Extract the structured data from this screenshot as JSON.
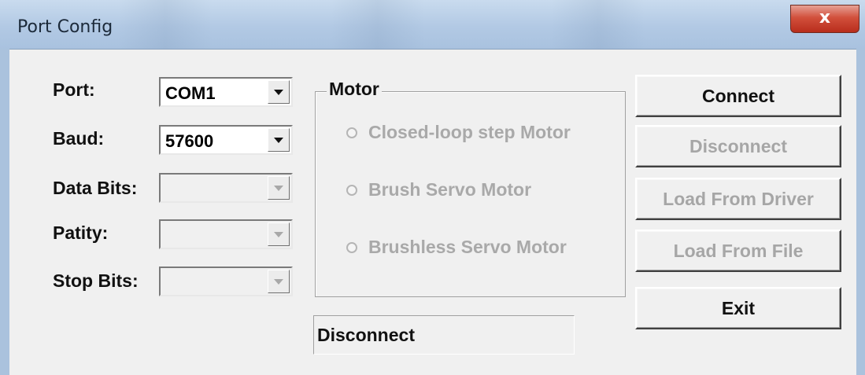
{
  "window": {
    "title": "Port Config",
    "close_label": "x"
  },
  "fields": [
    {
      "label": "Port:",
      "value": "COM1",
      "disabled": false
    },
    {
      "label": "Baud:",
      "value": "57600",
      "disabled": false
    },
    {
      "label": "Data Bits:",
      "value": "",
      "disabled": true
    },
    {
      "label": "Patity:",
      "value": "",
      "disabled": true
    },
    {
      "label": "Stop Bits:",
      "value": "",
      "disabled": true
    }
  ],
  "motor": {
    "title": "Motor",
    "options": [
      {
        "label": "Closed-loop step Motor",
        "selected": false,
        "disabled": true
      },
      {
        "label": "Brush Servo Motor",
        "selected": false,
        "disabled": true
      },
      {
        "label": "Brushless Servo Motor",
        "selected": false,
        "disabled": true
      }
    ]
  },
  "buttons": {
    "connect": "Connect",
    "disconnect": "Disconnect",
    "load_from_driver": "Load From Driver",
    "load_from_file": "Load From File",
    "exit": "Exit"
  },
  "status_text": "Disconnect"
}
